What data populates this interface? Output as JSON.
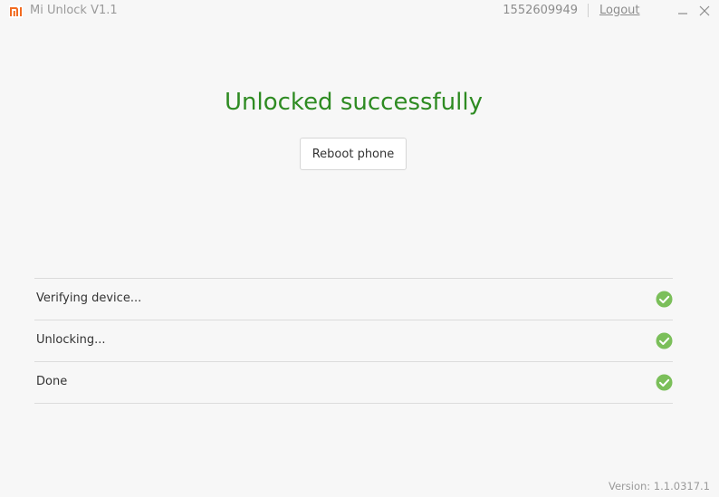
{
  "app": {
    "title": "Mi Unlock  V1.1",
    "brand_color": "#f26b20"
  },
  "account": {
    "id": "1552609949",
    "logout_label": "Logout"
  },
  "main": {
    "status_title": "Unlocked successfully",
    "status_color": "#2e8b22",
    "reboot_label": "Reboot phone"
  },
  "steps": [
    {
      "label": "Verifying device...",
      "status": "check-icon"
    },
    {
      "label": "Unlocking...",
      "status": "check-icon"
    },
    {
      "label": "Done",
      "status": "check-icon"
    }
  ],
  "footer": {
    "version": "Version: 1.1.0317.1"
  },
  "colors": {
    "check": "#7bbf5a"
  }
}
